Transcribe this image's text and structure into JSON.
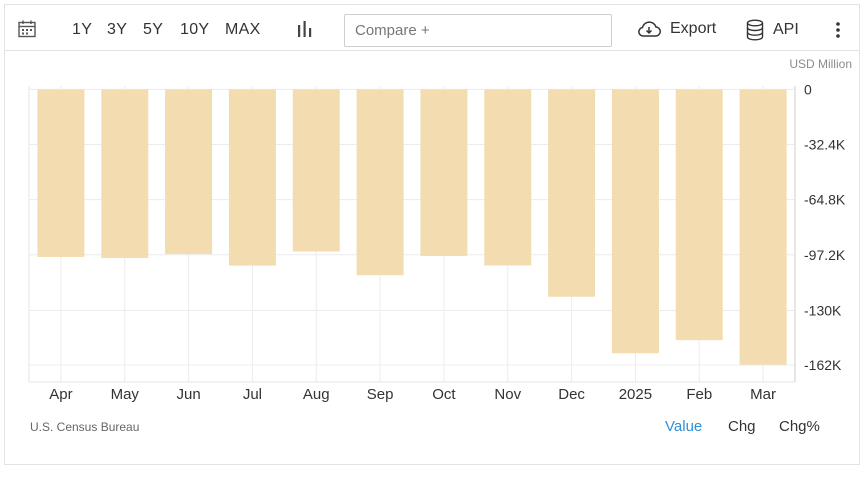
{
  "toolbar": {
    "calendar_icon": "calendar-icon",
    "ranges": [
      "1Y",
      "3Y",
      "5Y",
      "10Y",
      "MAX"
    ],
    "chart_type_icon": "bar-chart-icon",
    "compare_placeholder": "Compare +",
    "export_label": "Export",
    "export_icon": "cloud-download-icon",
    "api_label": "API",
    "api_icon": "database-icon",
    "more_icon": "kebab-menu-icon"
  },
  "unit_label": "USD Million",
  "source_label": "U.S. Census Bureau",
  "modes": {
    "value": "Value",
    "chg": "Chg",
    "chg_pct": "Chg%"
  },
  "colors": {
    "bar": "#f3ddb0",
    "active_mode": "#2f8fd8",
    "grid": "#ececec"
  },
  "chart_data": {
    "type": "bar",
    "categories": [
      "Apr",
      "May",
      "Jun",
      "Jul",
      "Aug",
      "Sep",
      "Oct",
      "Nov",
      "Dec",
      "2025",
      "Feb",
      "Mar"
    ],
    "values": [
      -98.5,
      -99.1,
      -96.8,
      -103.6,
      -95.3,
      -109.2,
      -97.9,
      -103.5,
      -121.9,
      -155.1,
      -147.4,
      -161.8
    ],
    "ylim": [
      -172,
      2
    ],
    "y_ticks": [
      0,
      -32.4,
      -64.8,
      -97.2,
      -130,
      -162
    ],
    "y_tick_labels": [
      "0",
      "-32.4K",
      "-64.8K",
      "-97.2K",
      "-130K",
      "-162K"
    ],
    "ylabel": "USD Million",
    "grid": true,
    "y_axis_position": "right"
  }
}
